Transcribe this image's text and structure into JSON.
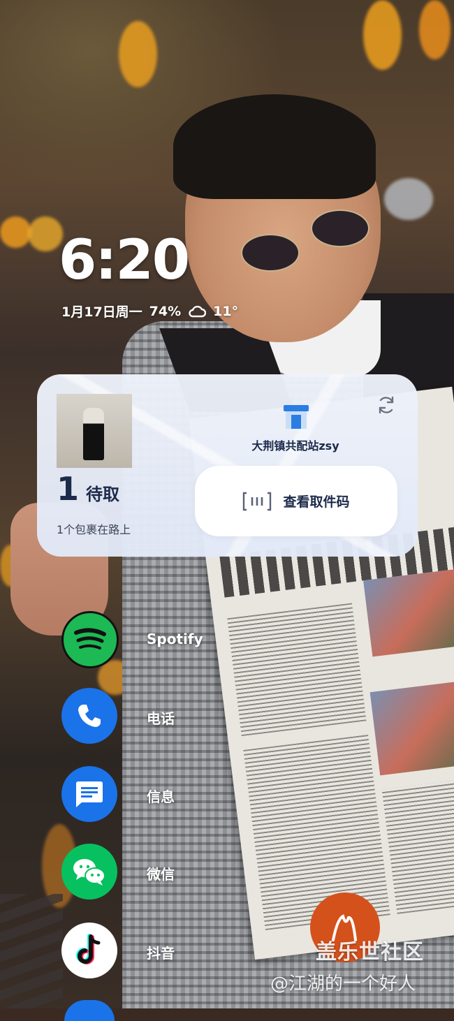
{
  "lockscreen": {
    "time": "6:20",
    "date": "1月17日周一",
    "battery": "74%",
    "weather_icon": "cloud-icon",
    "temperature": "11°"
  },
  "parcel_widget": {
    "pending_count": "1",
    "pending_label": "待取",
    "in_transit_text": "1个包裹在路上",
    "station_name": "大荆镇共配站zsy",
    "pickup_code_label": "查看取件码",
    "icons": [
      "refresh-icon",
      "station-icon",
      "scan-code-icon"
    ]
  },
  "apps": [
    {
      "name": "Spotify",
      "icon": "spotify-icon",
      "color": "#1DB954"
    },
    {
      "name": "电话",
      "icon": "phone-icon",
      "color": "#1A73E8"
    },
    {
      "name": "信息",
      "icon": "message-icon",
      "color": "#1A73E8"
    },
    {
      "name": "微信",
      "icon": "wechat-icon",
      "color": "#07C160"
    },
    {
      "name": "抖音",
      "icon": "tiktok-icon",
      "color": "#FFFFFF"
    }
  ],
  "watermark": {
    "brand": "盖乐世社区",
    "handle": "@江湖的一个好人"
  }
}
